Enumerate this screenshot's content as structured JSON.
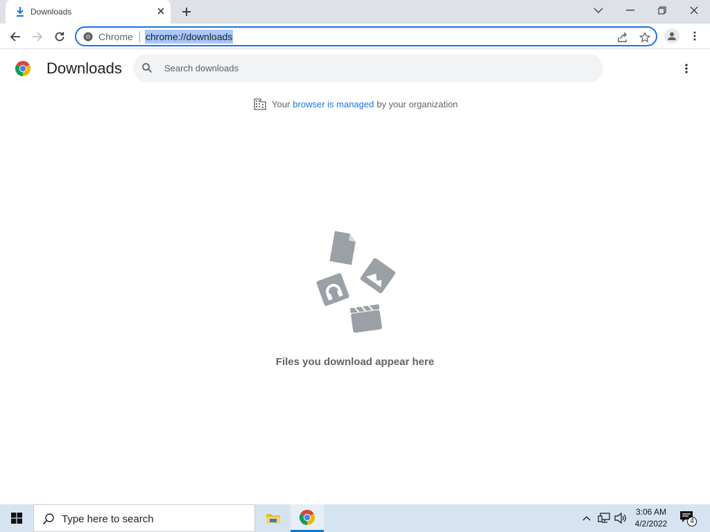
{
  "tab": {
    "title": "Downloads"
  },
  "omnibox": {
    "chip_label": "Chrome",
    "url": "chrome://downloads"
  },
  "page": {
    "title": "Downloads",
    "search_placeholder": "Search downloads",
    "managed_prefix": "Your",
    "managed_link": "browser is managed",
    "managed_suffix": "by your organization",
    "empty_message": "Files you download appear here"
  },
  "taskbar": {
    "search_placeholder": "Type here to search",
    "time": "3:06 AM",
    "date": "4/2/2022",
    "notification_count": "4"
  },
  "colors": {
    "accent": "#1a73e8",
    "illustration_gray": "#9aa0a6",
    "taskbar": "#d6e4f2"
  }
}
